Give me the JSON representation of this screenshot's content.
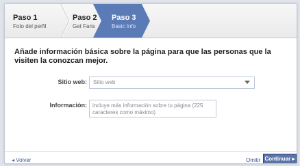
{
  "steps": [
    {
      "title": "Paso 1",
      "subtitle": "Foto del perfil"
    },
    {
      "title": "Paso 2",
      "subtitle": "Get Fans"
    },
    {
      "title": "Paso 3",
      "subtitle": "Basic Info"
    }
  ],
  "main": {
    "heading": "Añade información básica sobre la página para que las personas que la visiten la conozcan mejor.",
    "website_label": "Sitio web:",
    "website_select_value": "Sitio web",
    "info_label": "Información:",
    "info_placeholder": "incluye más información sobre tu página (225 caracteres como máximo)"
  },
  "footer": {
    "back": "◂ Volver",
    "skip": "Omitir",
    "continue": "Continuar ▸"
  },
  "colors": {
    "active_step": "#5b7bb6",
    "link": "#3b5998",
    "button": "#5b74a8"
  }
}
